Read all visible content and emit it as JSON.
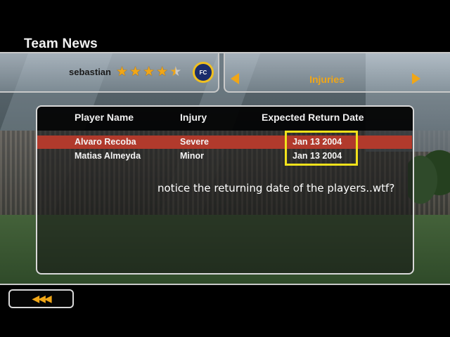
{
  "screen": {
    "title": "Team News"
  },
  "profile": {
    "name": "sebastian",
    "stars": 4.5,
    "club_logo_icon": "inter-milan-crest-icon",
    "club_logo_text": "FC"
  },
  "category": {
    "label": "Injuries",
    "prev_icon": "triangle-left-icon",
    "next_icon": "triangle-right-icon"
  },
  "table": {
    "headers": [
      "Player Name",
      "Injury",
      "Expected Return Date"
    ],
    "rows": [
      {
        "player": "Alvaro Recoba",
        "injury": "Severe",
        "return_date": "Jan 13 2004"
      },
      {
        "player": "Matias Almeyda",
        "injury": "Minor",
        "return_date": "Jan 13 2004"
      }
    ]
  },
  "annotation": "notice the returning date of the players..wtf?",
  "back_button": {
    "label": "◀◀◀"
  },
  "colors": {
    "accent": "#f0a617",
    "highlight_row": "#b13a2c",
    "annotation_box": "#f2e21b"
  }
}
